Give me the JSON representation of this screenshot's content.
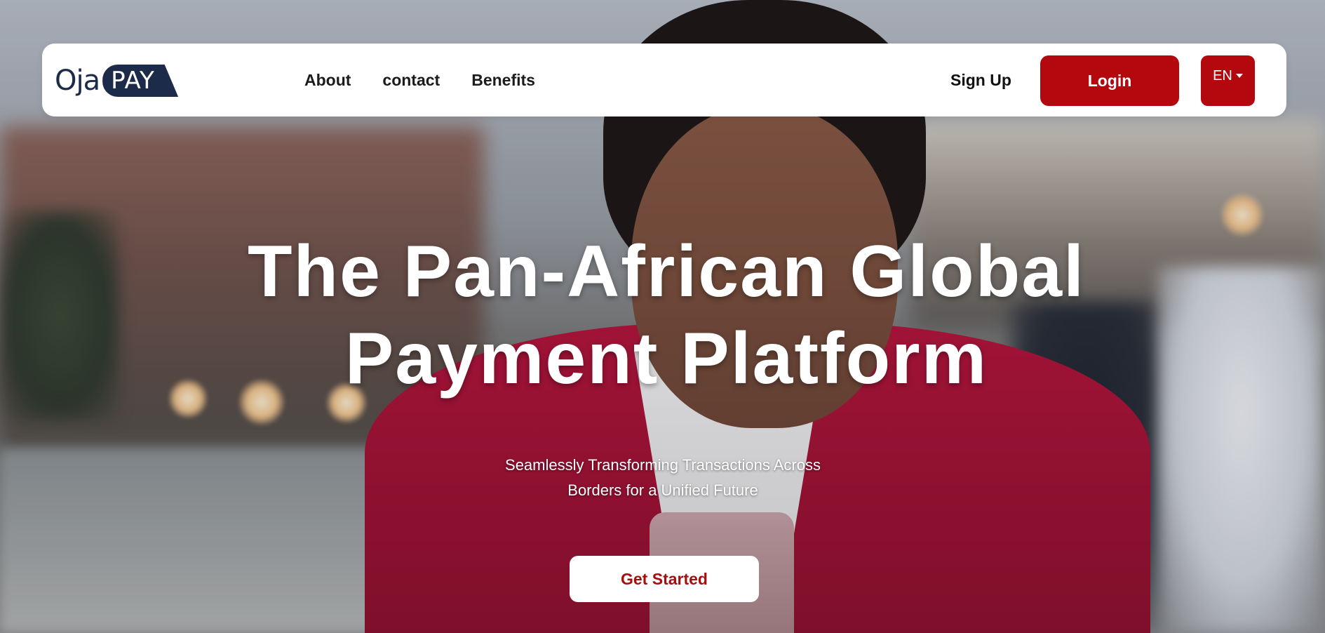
{
  "brand": {
    "logo_text_part1": "Oja",
    "logo_text_part2": "PAY",
    "primary_color": "#b4080f",
    "navy_color": "#1c2b4a"
  },
  "nav": {
    "links": [
      "About",
      "contact",
      "Benefits"
    ],
    "signup_label": "Sign Up",
    "login_label": "Login",
    "language_label": "EN"
  },
  "hero": {
    "headline_line1": "The Pan-African Global",
    "headline_line2": "Payment Platform",
    "subtitle_line1": "Seamlessly Transforming Transactions Across",
    "subtitle_line2": "Borders for a Unified Future",
    "cta_label": "Get Started"
  }
}
